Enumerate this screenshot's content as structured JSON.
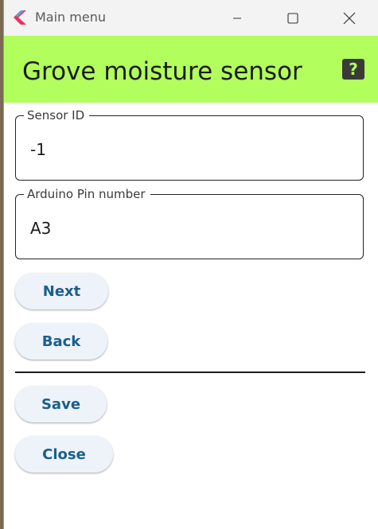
{
  "window": {
    "title": "Main menu",
    "icons": {
      "app": "flutter-app-icon",
      "minimize": "minimize-icon",
      "maximize": "maximize-icon",
      "close": "close-icon"
    }
  },
  "appbar": {
    "title": "Grove moisture sensor",
    "help_label": "?",
    "background": "#b2fe5c"
  },
  "form": {
    "sensor_id": {
      "label": "Sensor ID",
      "value": "-1"
    },
    "arduino_pin": {
      "label": "Arduino Pin number",
      "value": "A3"
    }
  },
  "buttons": {
    "next": "Next",
    "back": "Back",
    "save": "Save",
    "close": "Close"
  },
  "colors": {
    "button_text": "#1a5f8c",
    "button_bg": "#eef2f9"
  }
}
